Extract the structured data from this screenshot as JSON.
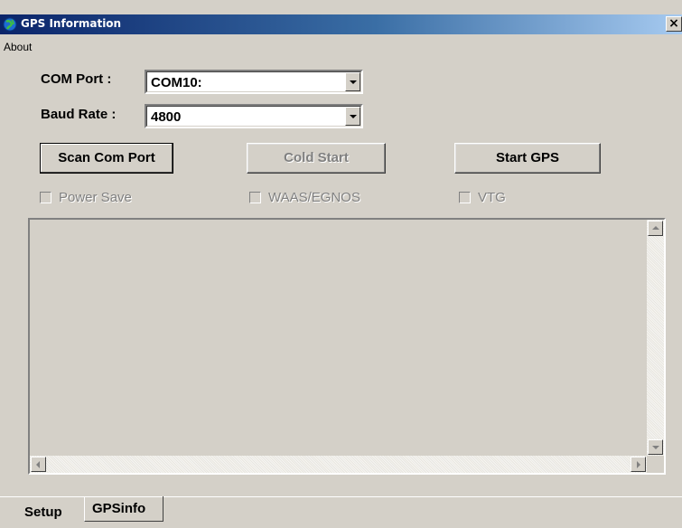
{
  "window": {
    "title": "GPS Information",
    "close_label": "×"
  },
  "menu": {
    "items": [
      {
        "label": "About"
      }
    ]
  },
  "form": {
    "com_port_label": "COM Port :",
    "com_port_value": "COM10:",
    "baud_rate_label": "Baud Rate :",
    "baud_rate_value": "4800"
  },
  "buttons": {
    "scan": "Scan Com Port",
    "cold_start": "Cold Start",
    "start_gps": "Start GPS"
  },
  "checkboxes": {
    "power_save": "Power Save",
    "waas": "WAAS/EGNOS",
    "vtg": "VTG"
  },
  "output": {
    "text": ""
  },
  "tabs": [
    {
      "label": "Setup",
      "active": true
    },
    {
      "label": "GPSinfo",
      "active": false
    }
  ],
  "colors": {
    "face": "#d4d0c8",
    "title_start": "#0a246a",
    "title_end": "#a6caf0",
    "disabled_text": "#808080"
  }
}
